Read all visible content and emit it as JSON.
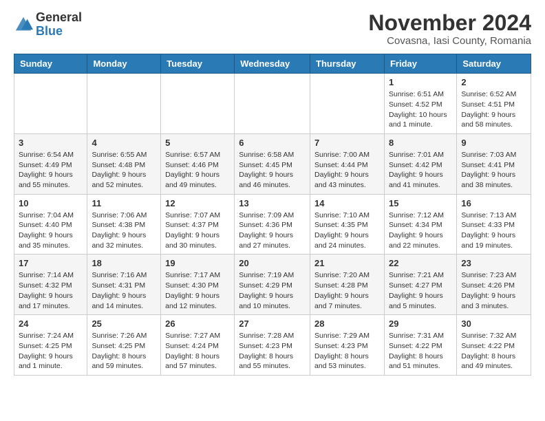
{
  "logo": {
    "general": "General",
    "blue": "Blue"
  },
  "title": {
    "month": "November 2024",
    "location": "Covasna, Iasi County, Romania"
  },
  "headers": [
    "Sunday",
    "Monday",
    "Tuesday",
    "Wednesday",
    "Thursday",
    "Friday",
    "Saturday"
  ],
  "weeks": [
    [
      {
        "day": "",
        "detail": ""
      },
      {
        "day": "",
        "detail": ""
      },
      {
        "day": "",
        "detail": ""
      },
      {
        "day": "",
        "detail": ""
      },
      {
        "day": "",
        "detail": ""
      },
      {
        "day": "1",
        "detail": "Sunrise: 6:51 AM\nSunset: 4:52 PM\nDaylight: 10 hours and 1 minute."
      },
      {
        "day": "2",
        "detail": "Sunrise: 6:52 AM\nSunset: 4:51 PM\nDaylight: 9 hours and 58 minutes."
      }
    ],
    [
      {
        "day": "3",
        "detail": "Sunrise: 6:54 AM\nSunset: 4:49 PM\nDaylight: 9 hours and 55 minutes."
      },
      {
        "day": "4",
        "detail": "Sunrise: 6:55 AM\nSunset: 4:48 PM\nDaylight: 9 hours and 52 minutes."
      },
      {
        "day": "5",
        "detail": "Sunrise: 6:57 AM\nSunset: 4:46 PM\nDaylight: 9 hours and 49 minutes."
      },
      {
        "day": "6",
        "detail": "Sunrise: 6:58 AM\nSunset: 4:45 PM\nDaylight: 9 hours and 46 minutes."
      },
      {
        "day": "7",
        "detail": "Sunrise: 7:00 AM\nSunset: 4:44 PM\nDaylight: 9 hours and 43 minutes."
      },
      {
        "day": "8",
        "detail": "Sunrise: 7:01 AM\nSunset: 4:42 PM\nDaylight: 9 hours and 41 minutes."
      },
      {
        "day": "9",
        "detail": "Sunrise: 7:03 AM\nSunset: 4:41 PM\nDaylight: 9 hours and 38 minutes."
      }
    ],
    [
      {
        "day": "10",
        "detail": "Sunrise: 7:04 AM\nSunset: 4:40 PM\nDaylight: 9 hours and 35 minutes."
      },
      {
        "day": "11",
        "detail": "Sunrise: 7:06 AM\nSunset: 4:38 PM\nDaylight: 9 hours and 32 minutes."
      },
      {
        "day": "12",
        "detail": "Sunrise: 7:07 AM\nSunset: 4:37 PM\nDaylight: 9 hours and 30 minutes."
      },
      {
        "day": "13",
        "detail": "Sunrise: 7:09 AM\nSunset: 4:36 PM\nDaylight: 9 hours and 27 minutes."
      },
      {
        "day": "14",
        "detail": "Sunrise: 7:10 AM\nSunset: 4:35 PM\nDaylight: 9 hours and 24 minutes."
      },
      {
        "day": "15",
        "detail": "Sunrise: 7:12 AM\nSunset: 4:34 PM\nDaylight: 9 hours and 22 minutes."
      },
      {
        "day": "16",
        "detail": "Sunrise: 7:13 AM\nSunset: 4:33 PM\nDaylight: 9 hours and 19 minutes."
      }
    ],
    [
      {
        "day": "17",
        "detail": "Sunrise: 7:14 AM\nSunset: 4:32 PM\nDaylight: 9 hours and 17 minutes."
      },
      {
        "day": "18",
        "detail": "Sunrise: 7:16 AM\nSunset: 4:31 PM\nDaylight: 9 hours and 14 minutes."
      },
      {
        "day": "19",
        "detail": "Sunrise: 7:17 AM\nSunset: 4:30 PM\nDaylight: 9 hours and 12 minutes."
      },
      {
        "day": "20",
        "detail": "Sunrise: 7:19 AM\nSunset: 4:29 PM\nDaylight: 9 hours and 10 minutes."
      },
      {
        "day": "21",
        "detail": "Sunrise: 7:20 AM\nSunset: 4:28 PM\nDaylight: 9 hours and 7 minutes."
      },
      {
        "day": "22",
        "detail": "Sunrise: 7:21 AM\nSunset: 4:27 PM\nDaylight: 9 hours and 5 minutes."
      },
      {
        "day": "23",
        "detail": "Sunrise: 7:23 AM\nSunset: 4:26 PM\nDaylight: 9 hours and 3 minutes."
      }
    ],
    [
      {
        "day": "24",
        "detail": "Sunrise: 7:24 AM\nSunset: 4:25 PM\nDaylight: 9 hours and 1 minute."
      },
      {
        "day": "25",
        "detail": "Sunrise: 7:26 AM\nSunset: 4:25 PM\nDaylight: 8 hours and 59 minutes."
      },
      {
        "day": "26",
        "detail": "Sunrise: 7:27 AM\nSunset: 4:24 PM\nDaylight: 8 hours and 57 minutes."
      },
      {
        "day": "27",
        "detail": "Sunrise: 7:28 AM\nSunset: 4:23 PM\nDaylight: 8 hours and 55 minutes."
      },
      {
        "day": "28",
        "detail": "Sunrise: 7:29 AM\nSunset: 4:23 PM\nDaylight: 8 hours and 53 minutes."
      },
      {
        "day": "29",
        "detail": "Sunrise: 7:31 AM\nSunset: 4:22 PM\nDaylight: 8 hours and 51 minutes."
      },
      {
        "day": "30",
        "detail": "Sunrise: 7:32 AM\nSunset: 4:22 PM\nDaylight: 8 hours and 49 minutes."
      }
    ]
  ]
}
